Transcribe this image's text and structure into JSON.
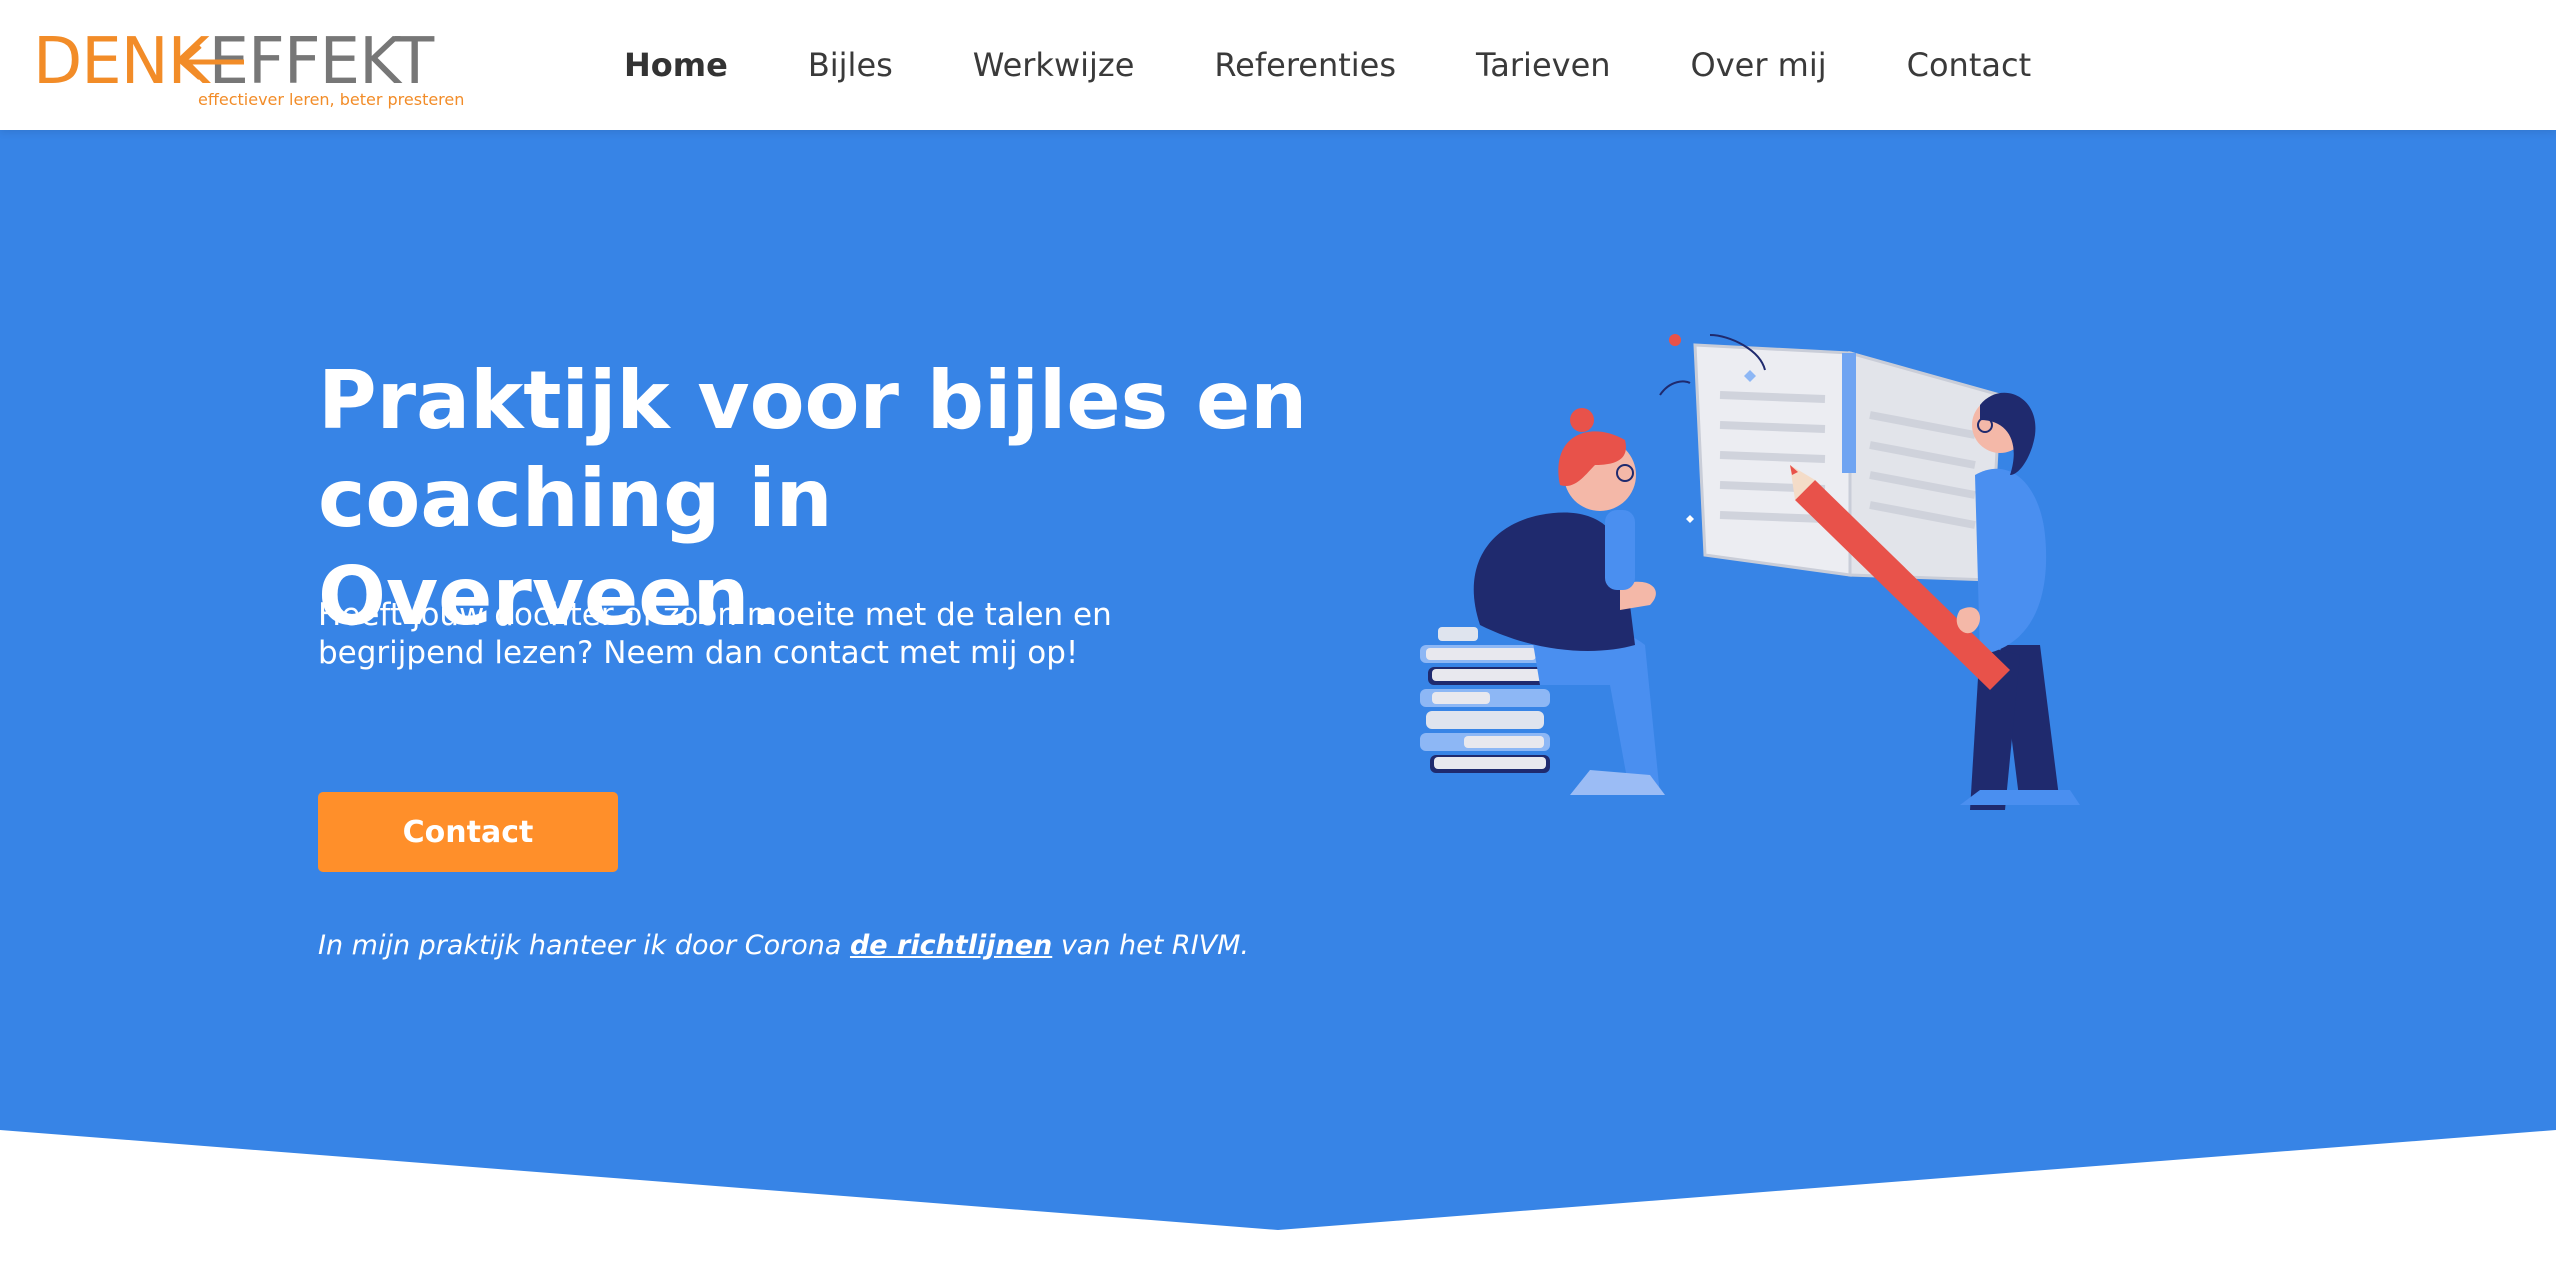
{
  "brand": {
    "name_part1": "DENK",
    "name_part2": "EFFEKT",
    "tagline": "effectiever leren, beter presteren"
  },
  "nav": {
    "items": [
      {
        "label": "Home",
        "active": true
      },
      {
        "label": "Bijles"
      },
      {
        "label": "Werkwijze"
      },
      {
        "label": "Referenties"
      },
      {
        "label": "Tarieven"
      },
      {
        "label": "Over mij"
      },
      {
        "label": "Contact"
      }
    ]
  },
  "hero": {
    "title_line1": "Praktijk voor bijles en",
    "title_line2": "coaching in Overveen.",
    "subtitle_line1": "Heeft jouw dochter of zoon moeite met de talen en",
    "subtitle_line2": "begrijpend lezen? Neem dan contact met mij op!",
    "cta_label": "Contact",
    "note_prefix": "In mijn praktijk hanteer ik door Corona ",
    "note_link": "de richtlijnen",
    "note_suffix": " van het RIVM."
  },
  "colors": {
    "brand_orange": "#f28c28",
    "hero_blue": "#3784e6",
    "cta_orange": "#ff8f2a",
    "logo_grey": "#777777"
  }
}
